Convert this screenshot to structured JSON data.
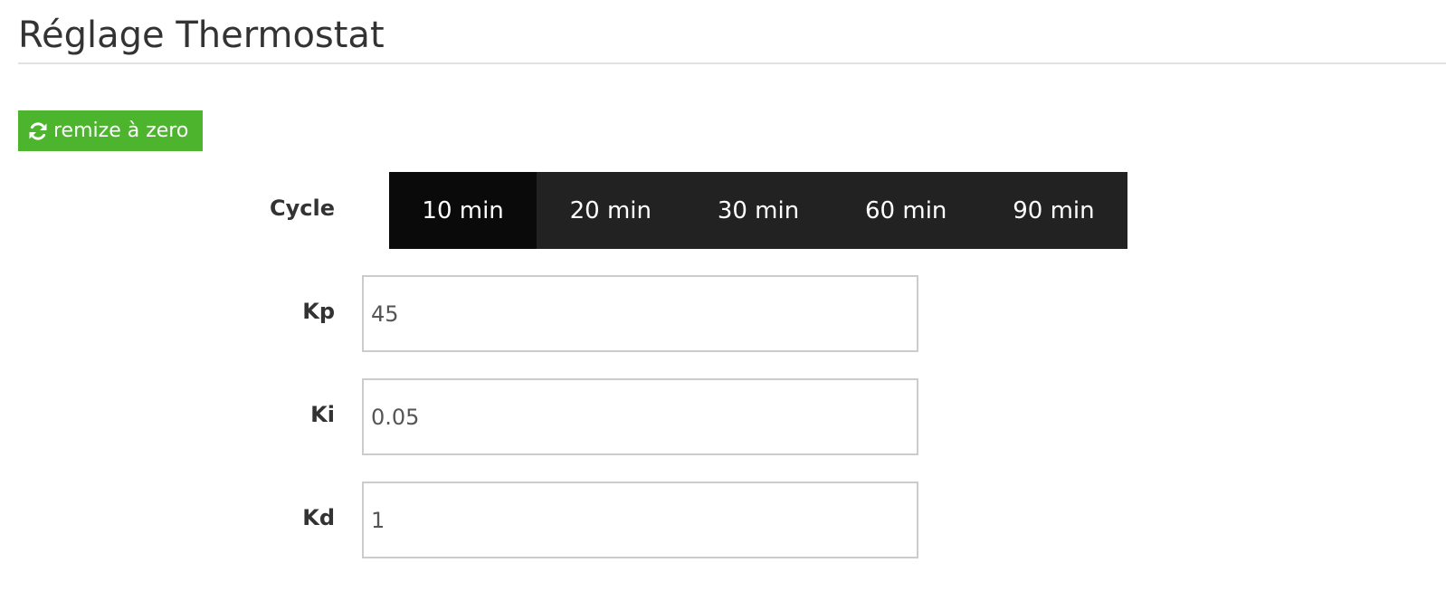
{
  "header": {
    "title": "Réglage Thermostat"
  },
  "toolbar": {
    "reset_label": "remize à zero",
    "reset_icon": "refresh-icon",
    "reset_color": "#4cb52d"
  },
  "cycle": {
    "label": "Cycle",
    "options": [
      "10 min",
      "20 min",
      "30 min",
      "60 min",
      "90 min"
    ],
    "selected": "10 min"
  },
  "params": {
    "kp": {
      "label": "Kp",
      "value": "45"
    },
    "ki": {
      "label": "Ki",
      "value": "0.05"
    },
    "kd": {
      "label": "Kd",
      "value": "1"
    }
  }
}
